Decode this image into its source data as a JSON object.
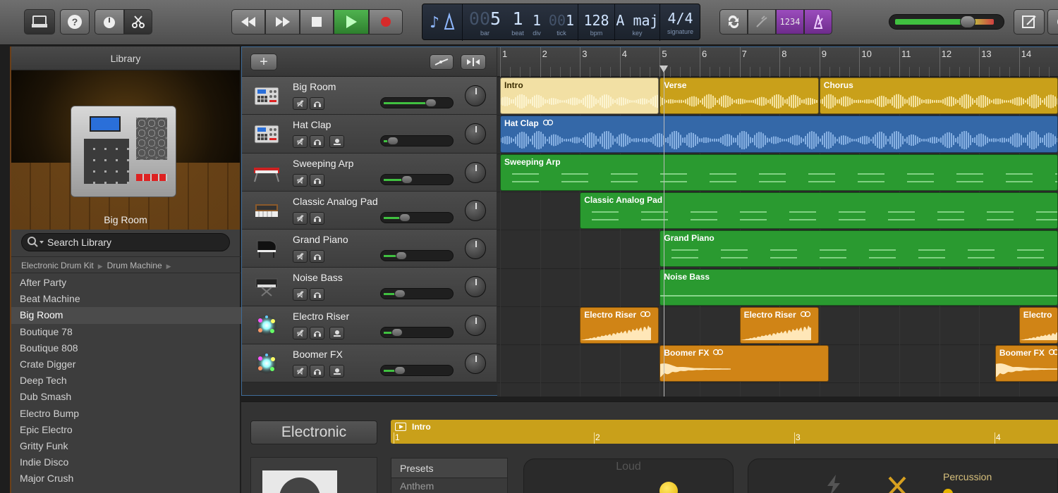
{
  "toolbar": {
    "lcd": {
      "bar": "5",
      "bar_label": "bar",
      "beat": "1",
      "beat_label": "beat",
      "div": "1",
      "div_label": "div",
      "tick": "1",
      "tick_label": "tick",
      "bpm": "128",
      "bpm_label": "bpm",
      "key": "A maj",
      "key_label": "key",
      "signature": "4/4",
      "signature_label": "signature"
    },
    "count_in_label": "1234",
    "colors": {
      "play": "#3a9a3a",
      "record": "#d62a2a",
      "count_in_bg": "#8a3aa8"
    }
  },
  "library": {
    "title": "Library",
    "preview_caption": "Big Room",
    "search_placeholder": "Search Library",
    "breadcrumb": [
      "Electronic Drum Kit",
      "Drum Machine"
    ],
    "items": [
      "After Party",
      "Beat Machine",
      "Big Room",
      "Boutique 78",
      "Boutique 808",
      "Crate Digger",
      "Deep Tech",
      "Dub Smash",
      "Electro Bump",
      "Epic Electro",
      "Gritty Funk",
      "Indie Disco",
      "Major Crush"
    ],
    "selected": "Big Room"
  },
  "tracks": [
    {
      "name": "Big Room",
      "icon": "drum-machine-icon",
      "volume": 0.72,
      "has_extra_btn": false
    },
    {
      "name": "Hat Clap",
      "icon": "drum-machine-icon",
      "volume": 0.16,
      "has_extra_btn": true
    },
    {
      "name": "Sweeping Arp",
      "icon": "synth-keyboard-icon",
      "volume": 0.36,
      "has_extra_btn": false
    },
    {
      "name": "Classic Analog Pad",
      "icon": "analog-synth-icon",
      "volume": 0.33,
      "has_extra_btn": false
    },
    {
      "name": "Grand Piano",
      "icon": "grand-piano-icon",
      "volume": 0.28,
      "has_extra_btn": false
    },
    {
      "name": "Noise Bass",
      "icon": "keyboard-stand-icon",
      "volume": 0.26,
      "has_extra_btn": false
    },
    {
      "name": "Electro Riser",
      "icon": "sparkle-fx-icon",
      "volume": 0.22,
      "has_extra_btn": true
    },
    {
      "name": "Boomer FX",
      "icon": "sparkle-fx-icon",
      "volume": 0.26,
      "has_extra_btn": true
    }
  ],
  "ruler": {
    "bars": [
      "1",
      "2",
      "3",
      "4",
      "5",
      "6",
      "7",
      "8",
      "9",
      "10",
      "11",
      "12",
      "13",
      "14"
    ]
  },
  "regions": {
    "intro": "Intro",
    "verse": "Verse",
    "chorus": "Chorus",
    "hat_clap": "Hat Clap",
    "sweeping_arp": "Sweeping Arp",
    "classic_analog_pad": "Classic Analog Pad",
    "grand_piano": "Grand Piano",
    "noise_bass": "Noise Bass",
    "electro_riser": "Electro Riser",
    "electro_riser_partial": "Electro",
    "boomer_fx": "Boomer FX"
  },
  "editor": {
    "style": "Electronic",
    "region_title": "Intro",
    "bars": [
      "1",
      "2",
      "3",
      "4"
    ],
    "presets_header": "Presets",
    "presets": [
      "Anthem"
    ],
    "xy_label": "Loud",
    "drum_label": "Percussion"
  }
}
